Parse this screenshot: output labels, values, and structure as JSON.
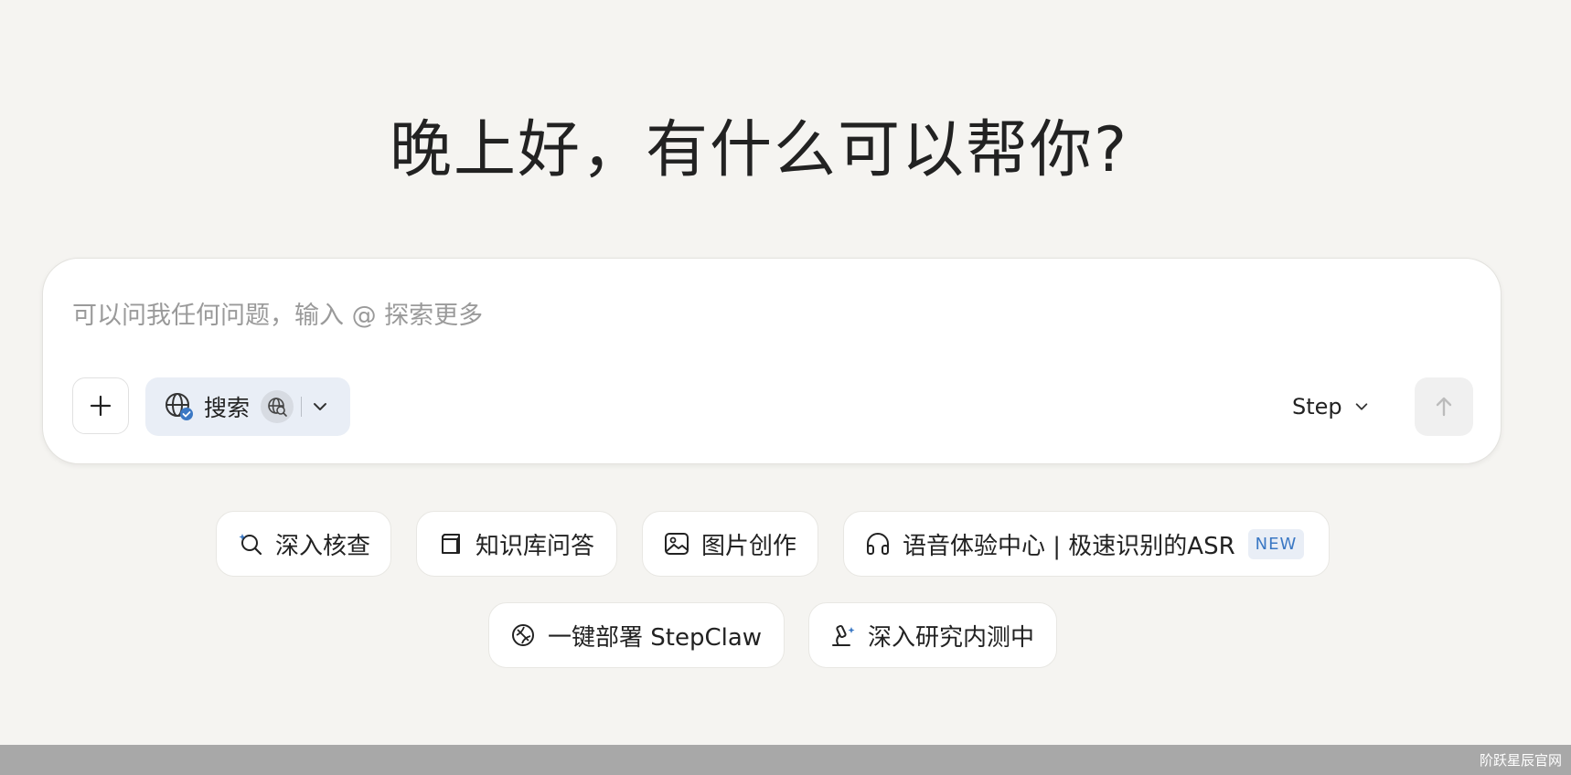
{
  "greeting": "晚上好，有什么可以帮你?",
  "composer": {
    "placeholder": "可以问我任何问题，输入 @ 探索更多",
    "search_label": "搜索",
    "model_label": "Step"
  },
  "quick_actions": [
    {
      "label": "深入核查",
      "icon": "search-sparkle-icon"
    },
    {
      "label": "知识库问答",
      "icon": "cube-icon"
    },
    {
      "label": "图片创作",
      "icon": "image-icon"
    },
    {
      "label": "语音体验中心 | 极速识别的ASR",
      "icon": "headphones-icon",
      "badge": "NEW"
    },
    {
      "label": "一键部署 StepClaw",
      "icon": "claw-icon"
    },
    {
      "label": "深入研究内测中",
      "icon": "microscope-icon"
    }
  ],
  "footer": {
    "watermark": "阶跃星辰官网"
  },
  "colors": {
    "accent": "#3b78c4",
    "background": "#f5f4f1",
    "pill": "#e9eef6"
  }
}
